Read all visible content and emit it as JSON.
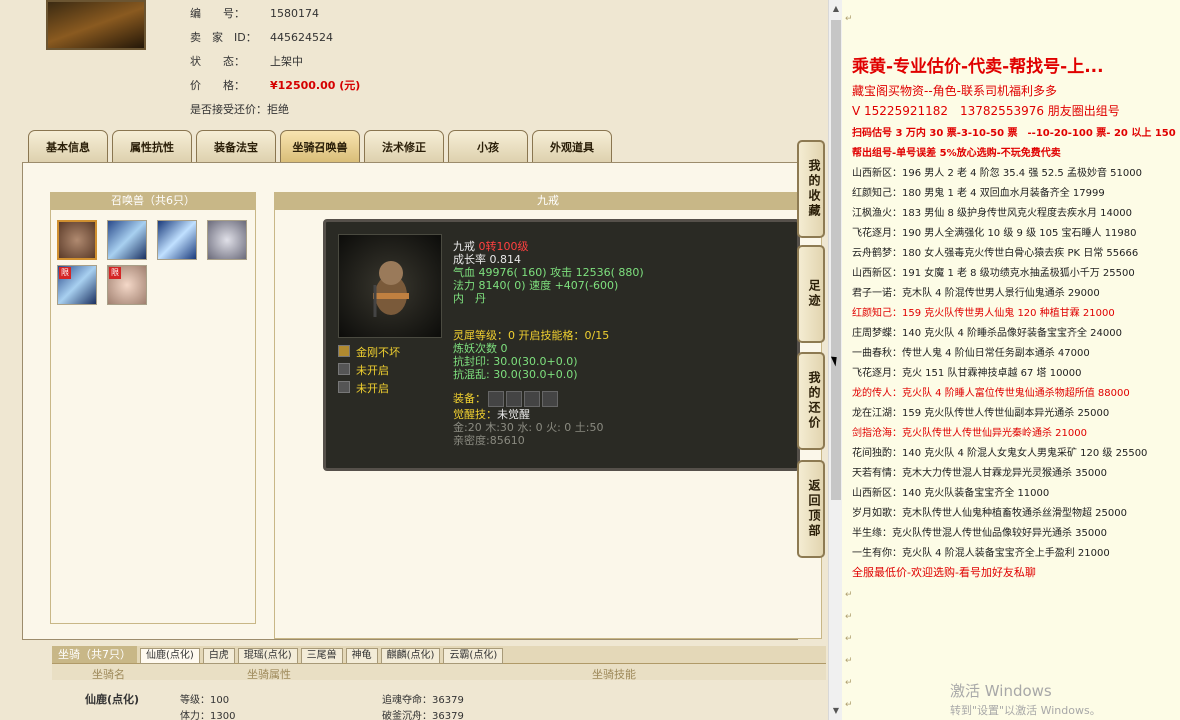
{
  "account": {
    "number_label": "编　　号：",
    "number": "1580174",
    "seller_label": "卖　家　ID：",
    "seller_id": "445624524",
    "status_label": "状　　态：",
    "status": "上架中",
    "price_label": "价　　格：",
    "price": "¥12500.00 (元)",
    "counter_label": "是否接受还价：",
    "counter": "拒绝"
  },
  "tabs": [
    "基本信息",
    "属性抗性",
    "装备法宝",
    "坐骑召唤兽",
    "法术修正",
    "小孩",
    "外观道具"
  ],
  "active_tab": "坐骑召唤兽",
  "pets": {
    "header": "召唤兽（共6只）",
    "limited_badge": "限"
  },
  "detail": {
    "header": "九戒",
    "name": "九戒",
    "reincarnation": "0转100级",
    "growth": "成长率 0.814",
    "hp": "气血 49976( 160)",
    "attack": "攻击 12536( 880)",
    "mana": "法力 8140( 0)",
    "speed": "速度 +407(-600)",
    "inner_dan": "内　丹",
    "skills": [
      "金刚不坏",
      "未开启",
      "未开启"
    ],
    "spirit_level": "灵犀等级：0 开启技能格：0/15",
    "refine_count": "炼妖次数 0",
    "resist_seal": "抗封印: 30.0(30.0+0.0)",
    "resist_confuse": "抗混乱: 30.0(30.0+0.0)",
    "equip_label": "装备：",
    "awaken_label": "觉醒技：",
    "awaken_value": "未觉醒",
    "elements": "金:20 木:30 水: 0 火: 0 土:50",
    "intimacy": "亲密度:85610"
  },
  "side_buttons": [
    "我的收藏",
    "足迹",
    "我的还价",
    "返回顶部"
  ],
  "mounts": {
    "header": "坐骑（共7只）",
    "tabs": [
      "仙鹿(点化)",
      "白虎",
      "琨瑶(点化)",
      "三尾兽",
      "神龟",
      "麒麟(点化)",
      "云霸(点化)"
    ],
    "col_name": "坐骑名",
    "col_attr": "坐骑属性",
    "col_skill": "坐骑技能",
    "name": "仙鹿(点化)",
    "level": "等级：100",
    "stamina": "体力：1300",
    "soul": "追魂夺命：36379",
    "armor": "破釜沉舟：36379"
  },
  "chat": {
    "title": "乘黄-专业估价-代卖-帮找号-上...",
    "lines": [
      {
        "text": "藏宝阁买物资--角色-联系司机福利多多",
        "color": "red",
        "size": "12px",
        "bold": false
      },
      {
        "text": "V 15225921182　13782553976 朋友圈出组号",
        "color": "red",
        "size": "12px",
        "bold": false
      },
      {
        "text": "扫码估号 3 万内 30 票-3-10-50 票　--10-20-100 票- 20 以上 150",
        "color": "red",
        "size": "10px",
        "bold": true
      },
      {
        "text": "帮出组号-单号误差 5%放心选购-不玩免费代卖",
        "color": "red",
        "size": "10px",
        "bold": true
      },
      {
        "text": "山西新区：196 男人 2 老 4 阶忽 35.4 强 52.5 孟极妙音 51000",
        "color": "black",
        "size": "10px",
        "bold": false
      },
      {
        "text": "红颜知己：180 男鬼 1 老 4 双回血水月装备齐全 17999",
        "color": "black",
        "size": "10px",
        "bold": false
      },
      {
        "text": "江枫渔火：183 男仙 8 级护身传世风克火程度去疾水月 14000",
        "color": "black",
        "size": "10px",
        "bold": false
      },
      {
        "text": "飞花逐月：190 男人全满强化 10 级 9 级 105 宝石睡人 11980",
        "color": "black",
        "size": "10px",
        "bold": false
      },
      {
        "text": "云舟鹤梦：180 女人强毒克火传世白骨心猿去疾 PK 日常 55666",
        "color": "black",
        "size": "10px",
        "bold": false
      },
      {
        "text": "山西新区：191 女魔 1 老 8 级功绩克水抽孟极狐小千万 25500",
        "color": "black",
        "size": "10px",
        "bold": false
      },
      {
        "text": "君子一诺：克木队 4 阶混传世男人景行仙鬼通杀 29000",
        "color": "black",
        "size": "10px",
        "bold": false
      },
      {
        "text": "红颜知己：159 克火队传世男人仙鬼 120 种植甘霖 21000",
        "color": "red",
        "size": "10px",
        "bold": false
      },
      {
        "text": "庄周梦蝶：140 克火队 4 阶睡杀品像好装备宝宝齐全 24000",
        "color": "black",
        "size": "10px",
        "bold": false
      },
      {
        "text": "一曲春秋：传世人鬼 4 阶仙日常任务副本通杀 47000",
        "color": "black",
        "size": "10px",
        "bold": false
      },
      {
        "text": "飞花逐月：克火 151 队甘霖神技卓越 67 塔 10000",
        "color": "black",
        "size": "10px",
        "bold": false
      },
      {
        "text": "龙的传人：克火队 4 阶睡人富位传世鬼仙通杀物超所值 88000",
        "color": "red",
        "size": "10px",
        "bold": false
      },
      {
        "text": "龙在江湖：159 克火队传世人传世仙副本异光通杀 25000",
        "color": "black",
        "size": "10px",
        "bold": false
      },
      {
        "text": "剑指沧海：克火队传世人传世仙异光秦岭通杀 21000",
        "color": "red",
        "size": "10px",
        "bold": false
      },
      {
        "text": "花间独酌：140 克火队 4 阶混人女鬼女人男鬼采矿 120 级 25500",
        "color": "black",
        "size": "10px",
        "bold": false
      },
      {
        "text": "天若有情：克木大力传世混人甘霖龙异光灵猴通杀 35000",
        "color": "black",
        "size": "10px",
        "bold": false
      },
      {
        "text": "山西新区：140 克火队装备宝宝齐全 11000",
        "color": "black",
        "size": "10px",
        "bold": false
      },
      {
        "text": "岁月如歌：克木队传世人仙鬼种植畜牧通杀丝滑型物超 25000",
        "color": "black",
        "size": "10px",
        "bold": false
      },
      {
        "text": "半生缘：克火队传世混人传世仙品像较好异光通杀 35000",
        "color": "black",
        "size": "10px",
        "bold": false
      },
      {
        "text": "一生有你：克火队 4 阶混人装备宝宝齐全上手盈利 21000",
        "color": "black",
        "size": "10px",
        "bold": false
      },
      {
        "text": "全服最低价-欢迎选购-看号加好友私聊",
        "color": "red",
        "size": "11px",
        "bold": false
      }
    ],
    "watermark_1": "激活 Windows",
    "watermark_2": "转到\"设置\"以激活 Windows。"
  }
}
